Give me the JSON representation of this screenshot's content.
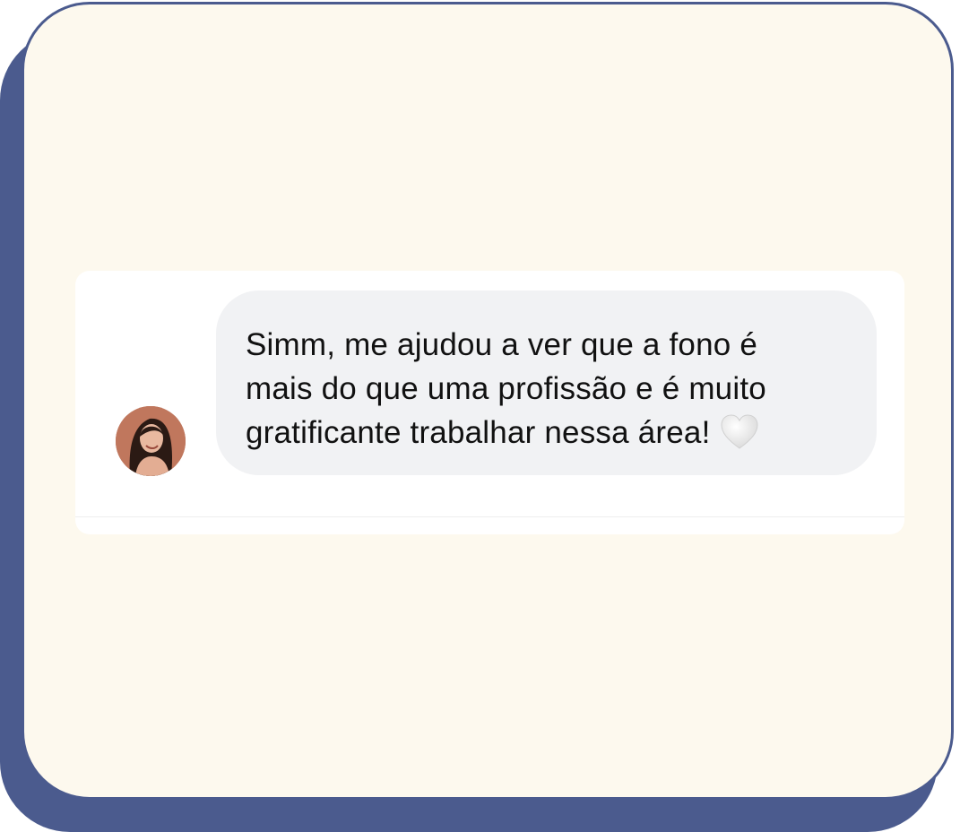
{
  "message": {
    "lines": [
      "Simm, me ajudou a ver que a fono é",
      "mais do que uma profissão e é muito",
      "gratificante trabalhar nessa área!"
    ],
    "reaction_icon": "white-heart-icon"
  },
  "colors": {
    "card_background": "#fdf9ee",
    "card_border": "#4b5b8e",
    "bubble_background": "#f1f2f4",
    "text": "#111111"
  }
}
